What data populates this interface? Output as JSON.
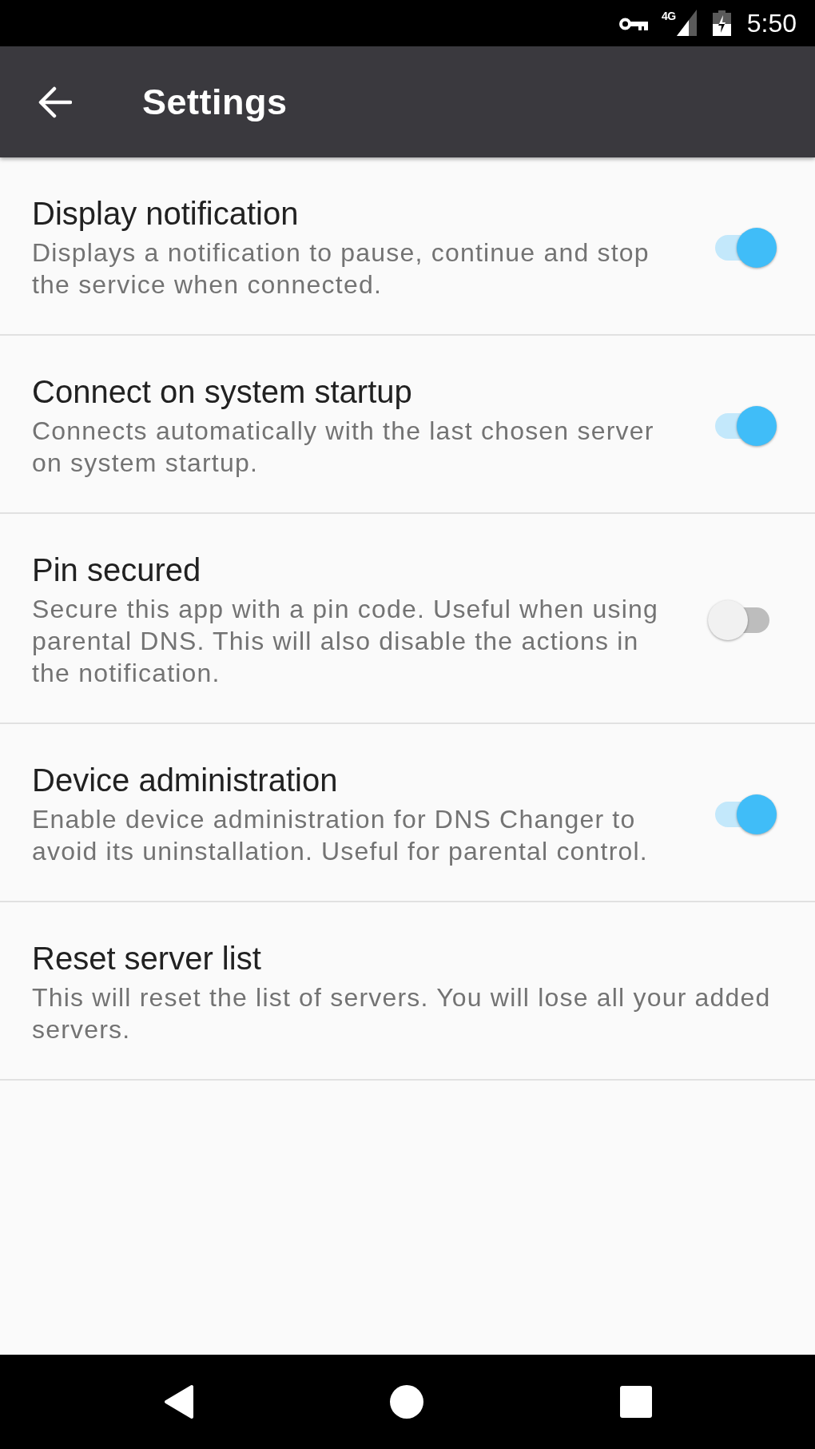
{
  "status_bar": {
    "network": "4G",
    "time": "5:50"
  },
  "app_bar": {
    "title": "Settings"
  },
  "settings": [
    {
      "kind": "switch",
      "title": "Display notification",
      "summary": "Displays a notification to pause, continue and stop the service when connected.",
      "on": true
    },
    {
      "kind": "switch",
      "title": "Connect on system startup",
      "summary": "Connects automatically with the last chosen server on system startup.",
      "on": true
    },
    {
      "kind": "switch",
      "title": "Pin secured",
      "summary": "Secure this app with a pin code. Useful when using parental DNS. This will also disable the actions in the notification.",
      "on": false
    },
    {
      "kind": "switch",
      "title": "Device administration",
      "summary": "Enable device administration for DNS Changer to avoid its uninstallation. Useful for parental control.",
      "on": true
    },
    {
      "kind": "action",
      "title": "Reset server list",
      "summary": "This will reset the list of servers. You will lose all your added servers."
    }
  ]
}
